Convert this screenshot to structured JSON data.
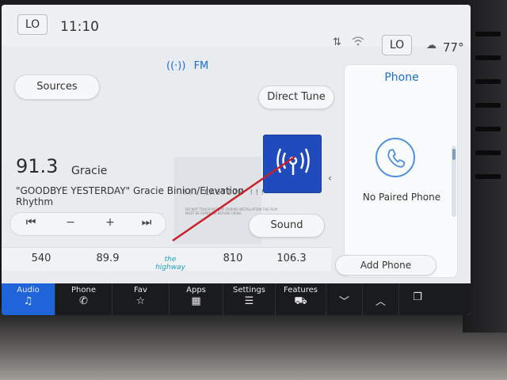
{
  "status": {
    "left_climate": "LO",
    "time": "11:10",
    "right_climate": "LO",
    "temperature": "77°"
  },
  "source": {
    "band": "FM"
  },
  "buttons": {
    "sources": "Sources",
    "direct_tune": "Direct Tune",
    "sound": "Sound",
    "add_phone": "Add Phone"
  },
  "now_playing": {
    "frequency": "91.3",
    "station": "Gracie",
    "song": "\"GOODBYE YESTERDAY\" Gracie Binion/Elevation Rhythm"
  },
  "controls": {
    "seek_back": "⏮",
    "minus": "−",
    "plus": "+",
    "seek_forward": "⏭"
  },
  "presets": [
    {
      "label": "540"
    },
    {
      "label": "89.9"
    },
    {
      "label": "the highway"
    },
    {
      "label": "810"
    },
    {
      "label": "106.3"
    }
  ],
  "sticker": {
    "caution": "!!! CAUTION !!!",
    "note": "DO NOT TOUCH DISPLAY DURING INSTALLATION THE FILM MUST BE REMOVED BEFORE USING"
  },
  "phone": {
    "title": "Phone",
    "status": "No Paired Phone"
  },
  "nav": [
    {
      "label": "Audio",
      "icon": "♫",
      "active": true
    },
    {
      "label": "Phone",
      "icon": "✆"
    },
    {
      "label": "Fav",
      "icon": "☆"
    },
    {
      "label": "Apps",
      "icon": "▦"
    },
    {
      "label": "Settings",
      "icon": "☰"
    },
    {
      "label": "Features",
      "icon": "⛟"
    },
    {
      "label": "",
      "icon": "﹀"
    },
    {
      "label": "",
      "icon": "︿"
    },
    {
      "label": "",
      "icon": "❐"
    }
  ],
  "colors": {
    "accent": "#1f64d8",
    "tile": "#1f4bbd",
    "pointer": "#c8202a"
  }
}
